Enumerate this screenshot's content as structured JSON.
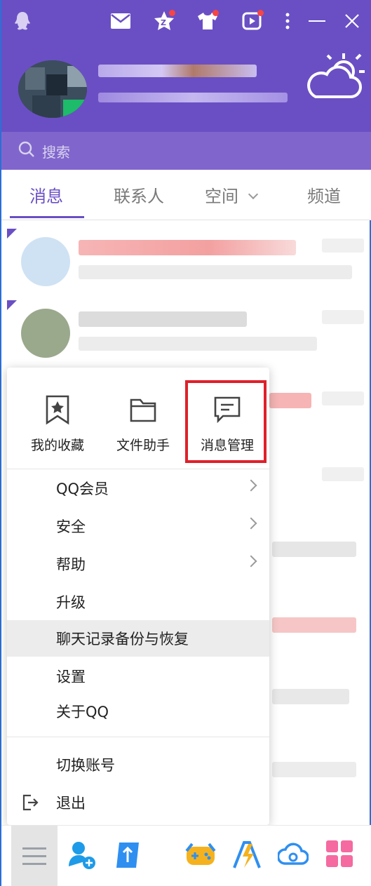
{
  "header": {
    "icons": [
      "qq-penguin-icon",
      "mail-icon",
      "qzone-star-icon",
      "theme-shirt-icon",
      "video-icon",
      "more-icon",
      "minimize-icon",
      "close-icon"
    ],
    "weather_icon": "cloud-sun-icon"
  },
  "search": {
    "placeholder": "搜索"
  },
  "tabs": [
    {
      "label": "消息",
      "active": true
    },
    {
      "label": "联系人",
      "active": false
    },
    {
      "label": "空间",
      "active": false,
      "has_dropdown": true
    },
    {
      "label": "频道",
      "active": false
    }
  ],
  "menu": {
    "quick_actions": [
      {
        "label": "我的收藏",
        "icon": "bookmark-star-icon"
      },
      {
        "label": "文件助手",
        "icon": "folder-icon"
      },
      {
        "label": "消息管理",
        "icon": "message-manage-icon",
        "highlighted": true
      }
    ],
    "items": [
      {
        "label": "QQ会员",
        "submenu": true
      },
      {
        "label": "安全",
        "submenu": true
      },
      {
        "label": "帮助",
        "submenu": true
      },
      {
        "label": "升级",
        "submenu": false
      },
      {
        "label": "聊天记录备份与恢复",
        "submenu": false,
        "hover": true
      },
      {
        "label": "设置",
        "submenu": false
      },
      {
        "label": "关于QQ",
        "submenu": false
      }
    ],
    "account_items": [
      {
        "label": "切换账号",
        "icon": ""
      },
      {
        "label": "退出",
        "icon": "logout-icon"
      }
    ]
  },
  "bottom_bar": {
    "icons": [
      "main-menu-icon",
      "add-contact-icon",
      "tencent-docs-icon",
      "game-center-icon",
      "qq-toolbox-icon",
      "weiyun-cloud-icon",
      "apps-grid-icon"
    ]
  },
  "colors": {
    "brand_purple": "#6a4fc4",
    "highlight_red": "#e0202a"
  }
}
